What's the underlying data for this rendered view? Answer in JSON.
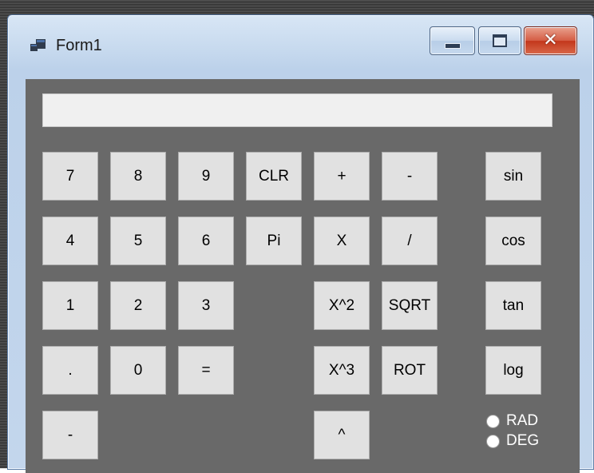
{
  "window": {
    "title": "Form1",
    "controls": {
      "minimize": "minimize-icon",
      "maximize": "maximize-icon",
      "close": "close-icon"
    }
  },
  "display": {
    "value": ""
  },
  "buttons": {
    "seven": "7",
    "eight": "8",
    "nine": "9",
    "clear": "CLR",
    "plus": "+",
    "minus": "-",
    "sin": "sin",
    "four": "4",
    "five": "5",
    "six": "6",
    "pi": "Pi",
    "multiply": "X",
    "divide": "/",
    "cos": "cos",
    "one": "1",
    "two": "2",
    "three": "3",
    "square": "X^2",
    "sqrt": "SQRT",
    "tan": "tan",
    "dot": ".",
    "zero": "0",
    "equals": "=",
    "cube": "X^3",
    "root": "ROT",
    "log": "log",
    "negate": "-",
    "power": "^"
  },
  "angle_mode": {
    "options": [
      "RAD",
      "DEG"
    ],
    "selected": ""
  },
  "colors": {
    "client_background": "#696969",
    "button_face": "#e1e1e1",
    "close_button": "#c3371b"
  }
}
